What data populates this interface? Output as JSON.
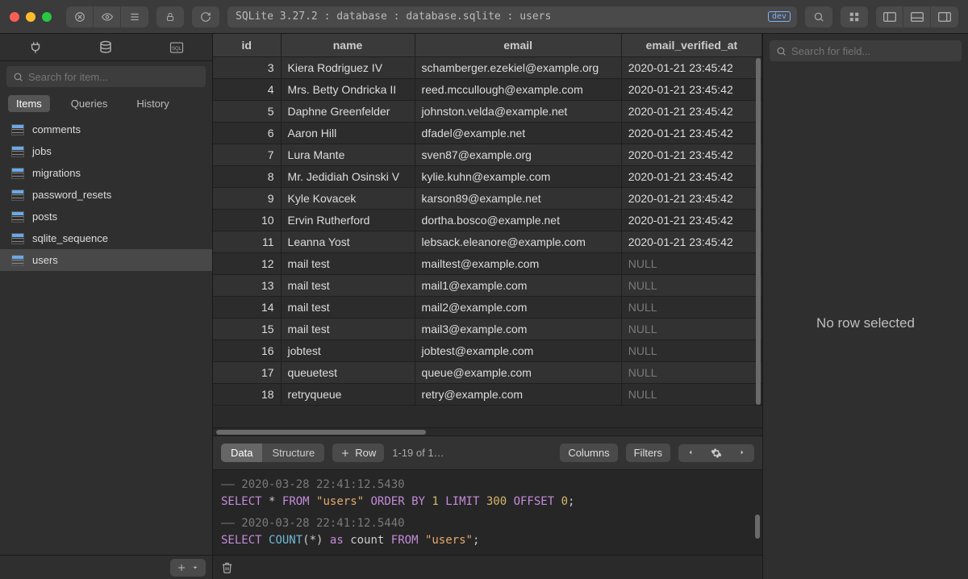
{
  "titlebar": {
    "breadcrumb": "SQLite 3.27.2 : database : database.sqlite : users",
    "badge": "dev"
  },
  "sidebar": {
    "search_placeholder": "Search for item...",
    "segments": [
      "Items",
      "Queries",
      "History"
    ],
    "active_segment": 0,
    "items": [
      {
        "label": "comments"
      },
      {
        "label": "jobs"
      },
      {
        "label": "migrations"
      },
      {
        "label": "password_resets"
      },
      {
        "label": "posts"
      },
      {
        "label": "sqlite_sequence"
      },
      {
        "label": "users"
      }
    ],
    "selected_item": 6
  },
  "table": {
    "columns": [
      "id",
      "name",
      "email",
      "email_verified_at"
    ],
    "rows": [
      {
        "id": "3",
        "name": "Kiera Rodriguez IV",
        "email": "schamberger.ezekiel@example.org",
        "date": "2020-01-21 23:45:42"
      },
      {
        "id": "4",
        "name": "Mrs. Betty Ondricka II",
        "email": "reed.mccullough@example.com",
        "date": "2020-01-21 23:45:42"
      },
      {
        "id": "5",
        "name": "Daphne Greenfelder",
        "email": "johnston.velda@example.net",
        "date": "2020-01-21 23:45:42"
      },
      {
        "id": "6",
        "name": "Aaron Hill",
        "email": "dfadel@example.net",
        "date": "2020-01-21 23:45:42"
      },
      {
        "id": "7",
        "name": "Lura Mante",
        "email": "sven87@example.org",
        "date": "2020-01-21 23:45:42"
      },
      {
        "id": "8",
        "name": "Mr. Jedidiah Osinski V",
        "email": "kylie.kuhn@example.com",
        "date": "2020-01-21 23:45:42"
      },
      {
        "id": "9",
        "name": "Kyle Kovacek",
        "email": "karson89@example.net",
        "date": "2020-01-21 23:45:42"
      },
      {
        "id": "10",
        "name": "Ervin Rutherford",
        "email": "dortha.bosco@example.net",
        "date": "2020-01-21 23:45:42"
      },
      {
        "id": "11",
        "name": "Leanna Yost",
        "email": "lebsack.eleanore@example.com",
        "date": "2020-01-21 23:45:42"
      },
      {
        "id": "12",
        "name": "mail test",
        "email": "mailtest@example.com",
        "date": null
      },
      {
        "id": "13",
        "name": "mail test",
        "email": "mail1@example.com",
        "date": null
      },
      {
        "id": "14",
        "name": "mail test",
        "email": "mail2@example.com",
        "date": null
      },
      {
        "id": "15",
        "name": "mail test",
        "email": "mail3@example.com",
        "date": null
      },
      {
        "id": "16",
        "name": "jobtest",
        "email": "jobtest@example.com",
        "date": null
      },
      {
        "id": "17",
        "name": "queuetest",
        "email": "queue@example.com",
        "date": null
      },
      {
        "id": "18",
        "name": "retryqueue",
        "email": "retry@example.com",
        "date": null
      }
    ],
    "null_label": "NULL"
  },
  "tablebar": {
    "tabs": [
      "Data",
      "Structure"
    ],
    "active_tab": 0,
    "add_row": "Row",
    "status": "1-19 of 1…",
    "columns_btn": "Columns",
    "filters_btn": "Filters"
  },
  "sql": {
    "line1_comment": "–– 2020-03-28 22:41:12.5430",
    "q1_select": "SELECT",
    "q1_star": "*",
    "q1_from": "FROM",
    "q1_table": "\"users\"",
    "q1_order": "ORDER BY",
    "q1_one": "1",
    "q1_limit": "LIMIT",
    "q1_limit_n": "300",
    "q1_offset": "OFFSET",
    "q1_offset_n": "0",
    "line2_comment": "–– 2020-03-28 22:41:12.5440",
    "q2_select": "SELECT",
    "q2_count": "COUNT",
    "q2_paren": "(*)",
    "q2_as": "as",
    "q2_alias": "count",
    "q2_from": "FROM",
    "q2_table": "\"users\""
  },
  "inspector": {
    "search_placeholder": "Search for field...",
    "empty": "No row selected"
  }
}
